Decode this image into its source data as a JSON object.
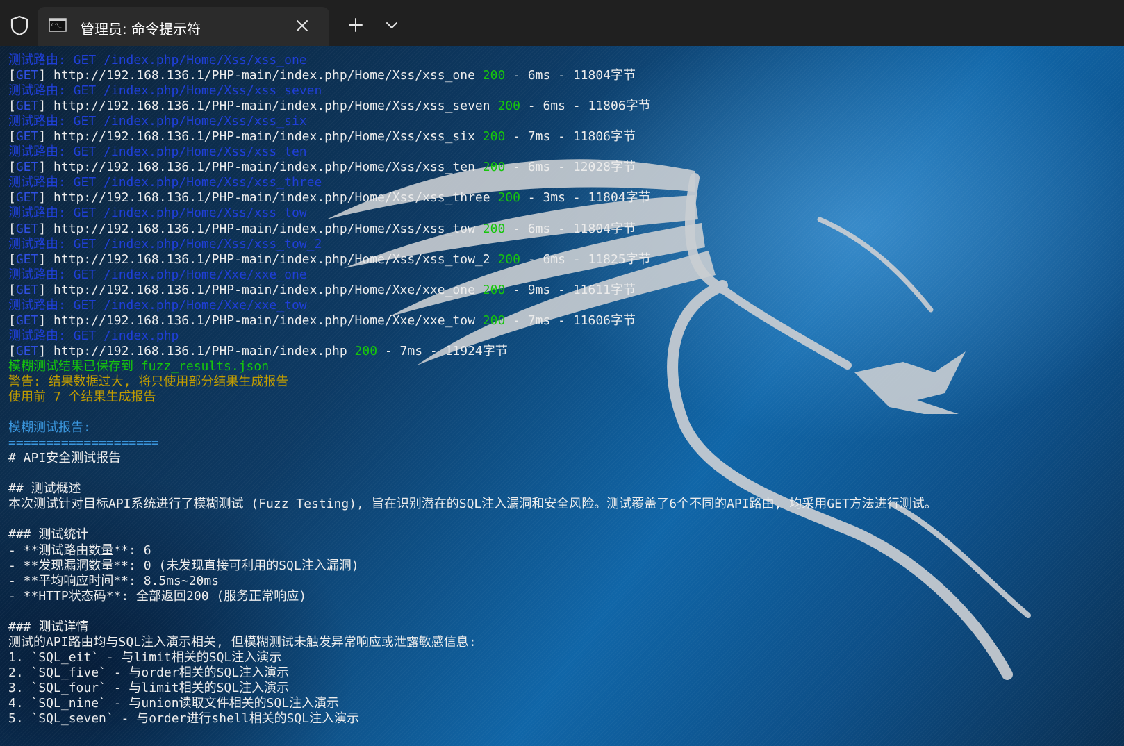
{
  "window": {
    "tab_title": "管理员: 命令提示符",
    "icons": [
      "shield-icon",
      "terminal-icon",
      "close-icon",
      "plus-icon",
      "chevron-down-icon"
    ]
  },
  "colors": {
    "route": "#1f3fd8",
    "status": "#16c60c",
    "warning": "#c19c00",
    "heading": "#3a96dd",
    "text": "#ececec"
  },
  "log": [
    {
      "route": "测试路由: GET /index.php/Home/Xss/xss_one",
      "method": "GET",
      "url": "http://192.168.136.1/PHP-main/index.php/Home/Xss/xss_one",
      "status": "200",
      "tail": " - 6ms - 11804字节"
    },
    {
      "route": "测试路由: GET /index.php/Home/Xss/xss_seven",
      "method": "GET",
      "url": "http://192.168.136.1/PHP-main/index.php/Home/Xss/xss_seven",
      "status": "200",
      "tail": " - 6ms - 11806字节"
    },
    {
      "route": "测试路由: GET /index.php/Home/Xss/xss_six",
      "method": "GET",
      "url": "http://192.168.136.1/PHP-main/index.php/Home/Xss/xss_six",
      "status": "200",
      "tail": " - 7ms - 11806字节"
    },
    {
      "route": "测试路由: GET /index.php/Home/Xss/xss_ten",
      "method": "GET",
      "url": "http://192.168.136.1/PHP-main/index.php/Home/Xss/xss_ten",
      "status": "200",
      "tail": " - 6ms - 12028字节"
    },
    {
      "route": "测试路由: GET /index.php/Home/Xss/xss_three",
      "method": "GET",
      "url": "http://192.168.136.1/PHP-main/index.php/Home/Xss/xss_three",
      "status": "200",
      "tail": " - 3ms - 11804字节"
    },
    {
      "route": "测试路由: GET /index.php/Home/Xss/xss_tow",
      "method": "GET",
      "url": "http://192.168.136.1/PHP-main/index.php/Home/Xss/xss_tow",
      "status": "200",
      "tail": " - 6ms - 11804字节"
    },
    {
      "route": "测试路由: GET /index.php/Home/Xss/xss_tow_2",
      "method": "GET",
      "url": "http://192.168.136.1/PHP-main/index.php/Home/Xss/xss_tow_2",
      "status": "200",
      "tail": " - 6ms - 11825字节"
    },
    {
      "route": "测试路由: GET /index.php/Home/Xxe/xxe_one",
      "method": "GET",
      "url": "http://192.168.136.1/PHP-main/index.php/Home/Xxe/xxe_one",
      "status": "200",
      "tail": " - 9ms - 11611字节"
    },
    {
      "route": "测试路由: GET /index.php/Home/Xxe/xxe_tow",
      "method": "GET",
      "url": "http://192.168.136.1/PHP-main/index.php/Home/Xxe/xxe_tow",
      "status": "200",
      "tail": " - 7ms - 11606字节"
    },
    {
      "route": "测试路由: GET /index.php",
      "method": "GET",
      "url": "http://192.168.136.1/PHP-main/index.php",
      "status": "200",
      "tail": " - 7ms - 11924字节"
    }
  ],
  "messages": {
    "saved": "模糊测试结果已保存到 fuzz_results.json",
    "warning": "警告: 结果数据过大, 将只使用部分结果生成报告",
    "using": "使用前 7 个结果生成报告"
  },
  "report": {
    "heading": "模糊测试报告:",
    "rule": "====================",
    "lines": [
      "# API安全测试报告",
      "",
      "## 测试概述",
      "本次测试针对目标API系统进行了模糊测试 (Fuzz Testing), 旨在识别潜在的SQL注入漏洞和安全风险。测试覆盖了6个不同的API路由, 均采用GET方法进行测试。",
      "",
      "### 测试统计",
      "- **测试路由数量**: 6",
      "- **发现漏洞数量**: 0 (未发现直接可利用的SQL注入漏洞)",
      "- **平均响应时间**: 8.5ms~20ms",
      "- **HTTP状态码**: 全部返回200 (服务正常响应)",
      "",
      "### 测试详情",
      "测试的API路由均与SQL注入演示相关, 但模糊测试未触发异常响应或泄露敏感信息:",
      "1. `SQL_eit` - 与limit相关的SQL注入演示",
      "2. `SQL_five` - 与order相关的SQL注入演示",
      "3. `SQL_four` - 与limit相关的SQL注入演示",
      "4. `SQL_nine` - 与union读取文件相关的SQL注入演示",
      "5. `SQL_seven` - 与order进行shell相关的SQL注入演示"
    ]
  }
}
